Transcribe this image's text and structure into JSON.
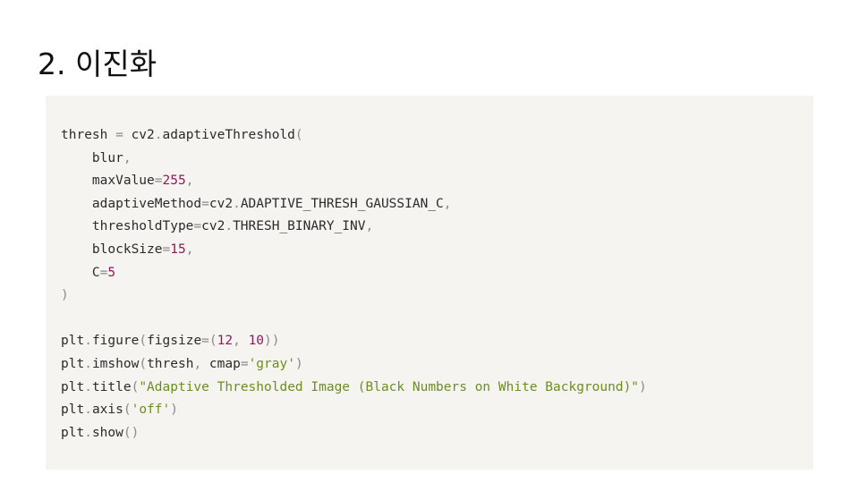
{
  "slide": {
    "title": "2. 이진화"
  },
  "code": {
    "lines": [
      [
        {
          "t": "thresh ",
          "c": ""
        },
        {
          "t": "=",
          "c": "p"
        },
        {
          "t": " cv2",
          "c": ""
        },
        {
          "t": ".",
          "c": "p"
        },
        {
          "t": "adaptiveThreshold",
          "c": ""
        },
        {
          "t": "(",
          "c": "p"
        }
      ],
      [
        {
          "t": "    blur",
          "c": ""
        },
        {
          "t": ",",
          "c": "p"
        }
      ],
      [
        {
          "t": "    maxValue",
          "c": ""
        },
        {
          "t": "=",
          "c": "p"
        },
        {
          "t": "255",
          "c": "n"
        },
        {
          "t": ",",
          "c": "p"
        }
      ],
      [
        {
          "t": "    adaptiveMethod",
          "c": ""
        },
        {
          "t": "=",
          "c": "p"
        },
        {
          "t": "cv2",
          "c": ""
        },
        {
          "t": ".",
          "c": "p"
        },
        {
          "t": "ADAPTIVE_THRESH_GAUSSIAN_C",
          "c": ""
        },
        {
          "t": ",",
          "c": "p"
        }
      ],
      [
        {
          "t": "    thresholdType",
          "c": ""
        },
        {
          "t": "=",
          "c": "p"
        },
        {
          "t": "cv2",
          "c": ""
        },
        {
          "t": ".",
          "c": "p"
        },
        {
          "t": "THRESH_BINARY_INV",
          "c": ""
        },
        {
          "t": ",",
          "c": "p"
        }
      ],
      [
        {
          "t": "    blockSize",
          "c": ""
        },
        {
          "t": "=",
          "c": "p"
        },
        {
          "t": "15",
          "c": "n"
        },
        {
          "t": ",",
          "c": "p"
        }
      ],
      [
        {
          "t": "    C",
          "c": ""
        },
        {
          "t": "=",
          "c": "p"
        },
        {
          "t": "5",
          "c": "n"
        }
      ],
      [
        {
          "t": ")",
          "c": "p"
        }
      ],
      [],
      [
        {
          "t": "plt",
          "c": ""
        },
        {
          "t": ".",
          "c": "p"
        },
        {
          "t": "figure",
          "c": ""
        },
        {
          "t": "(",
          "c": "p"
        },
        {
          "t": "figsize",
          "c": ""
        },
        {
          "t": "=(",
          "c": "p"
        },
        {
          "t": "12",
          "c": "n"
        },
        {
          "t": ", ",
          "c": "p"
        },
        {
          "t": "10",
          "c": "n"
        },
        {
          "t": "))",
          "c": "p"
        }
      ],
      [
        {
          "t": "plt",
          "c": ""
        },
        {
          "t": ".",
          "c": "p"
        },
        {
          "t": "imshow",
          "c": ""
        },
        {
          "t": "(",
          "c": "p"
        },
        {
          "t": "thresh",
          "c": ""
        },
        {
          "t": ", ",
          "c": "p"
        },
        {
          "t": "cmap",
          "c": ""
        },
        {
          "t": "=",
          "c": "p"
        },
        {
          "t": "'gray'",
          "c": "s"
        },
        {
          "t": ")",
          "c": "p"
        }
      ],
      [
        {
          "t": "plt",
          "c": ""
        },
        {
          "t": ".",
          "c": "p"
        },
        {
          "t": "title",
          "c": ""
        },
        {
          "t": "(",
          "c": "p"
        },
        {
          "t": "\"Adaptive Thresholded Image (Black Numbers on White Background)\"",
          "c": "s"
        },
        {
          "t": ")",
          "c": "p"
        }
      ],
      [
        {
          "t": "plt",
          "c": ""
        },
        {
          "t": ".",
          "c": "p"
        },
        {
          "t": "axis",
          "c": ""
        },
        {
          "t": "(",
          "c": "p"
        },
        {
          "t": "'off'",
          "c": "s"
        },
        {
          "t": ")",
          "c": "p"
        }
      ],
      [
        {
          "t": "plt",
          "c": ""
        },
        {
          "t": ".",
          "c": "p"
        },
        {
          "t": "show",
          "c": ""
        },
        {
          "t": "()",
          "c": "p"
        }
      ]
    ]
  }
}
